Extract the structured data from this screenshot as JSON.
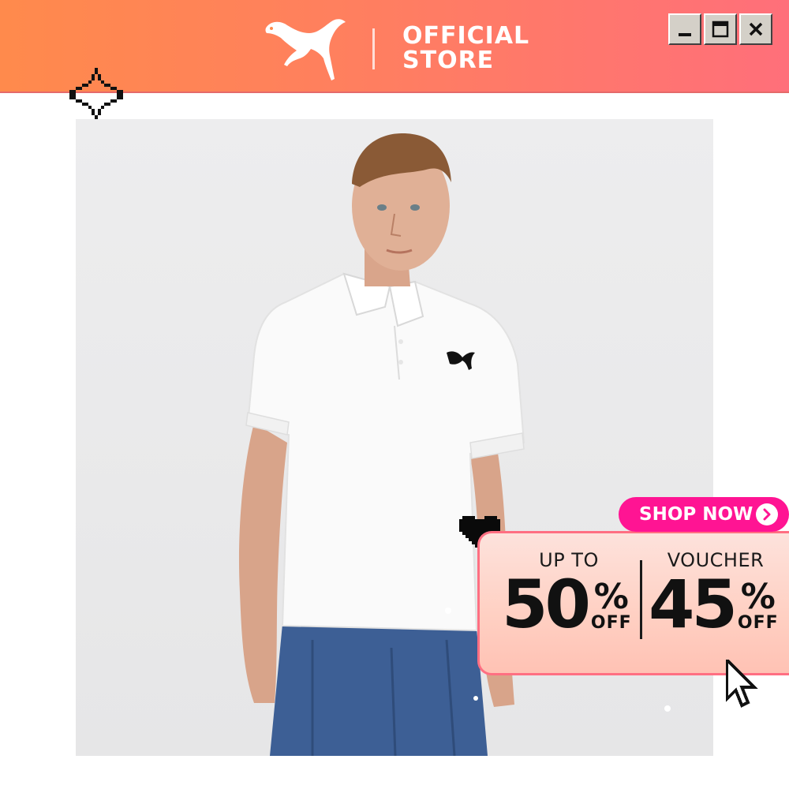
{
  "header": {
    "logo_icon": "puma-cat-icon",
    "store_line1": "OFFICIAL",
    "store_line2": "STORE",
    "window_controls": [
      "minimize-icon",
      "maximize-icon",
      "close-icon"
    ]
  },
  "decorations": {
    "sparkle_icon": "pixel-sparkle-icon",
    "heart_icon": "pixel-heart-icon",
    "cursor_icon": "pixel-cursor-icon"
  },
  "promo": {
    "shop_now_label": "SHOP NOW",
    "shop_now_icon": "chevron-right-icon",
    "discount": {
      "label": "UP TO",
      "value": "50",
      "percent": "%",
      "suffix": "OFF"
    },
    "voucher": {
      "label": "VOUCHER",
      "value": "45",
      "percent": "%",
      "suffix": "OFF"
    }
  },
  "colors": {
    "header_gradient_start": "#ff8a4c",
    "header_gradient_end": "#ff6f7a",
    "shop_now_bg": "#ff1493",
    "promo_border": "#ff6f82",
    "promo_bg": "#ffd1c4"
  }
}
